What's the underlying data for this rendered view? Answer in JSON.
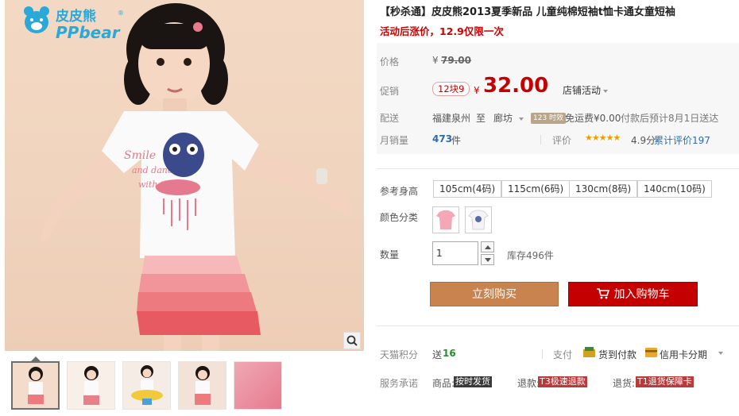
{
  "brand": {
    "logo_cn": "皮皮熊",
    "logo_en": "PPbear",
    "reg": "®"
  },
  "gallery": {
    "thumb_count": 5,
    "active_index": 0
  },
  "title": "【秒杀通】皮皮熊2013夏季新品 儿童纯棉短袖t恤卡通女童短袖",
  "subtitle": "活动后涨价，12.9仅限一次",
  "price": {
    "label": "价格",
    "currency": "¥",
    "original": "79.00"
  },
  "promo": {
    "label": "促销",
    "tag": "12块9",
    "currency": "¥",
    "value": "32.00",
    "shop_activity": "店铺活动"
  },
  "delivery": {
    "label": "配送",
    "from": "福建泉州",
    "to_word": "至",
    "to": "廊坊",
    "badge": "123 时效",
    "shipping": "免运费¥0.00",
    "eta": "付款后预计8月1日送达"
  },
  "sales": {
    "label": "月销量",
    "count": "473",
    "unit": "件",
    "rating_label": "评价",
    "stars": "★★★★★",
    "score": "4.9分",
    "total": "累计评价197"
  },
  "options": {
    "height_label": "参考身高",
    "sizes": [
      "105cm(4码)",
      "115cm(6码)",
      "130cm(8码)",
      "140cm(10码)"
    ],
    "color_label": "颜色分类"
  },
  "quantity": {
    "label": "数量",
    "value": "1",
    "stock": "库存496件"
  },
  "actions": {
    "buy_now": "立刻购买",
    "add_to_cart": "加入购物车"
  },
  "points": {
    "label": "天猫积分",
    "text": "送",
    "value": "16"
  },
  "payment": {
    "label": "支付",
    "cod": "货到付款",
    "credit": "信用卡分期"
  },
  "service": {
    "label": "服务承诺",
    "items": [
      {
        "prefix": "商品:",
        "tag": "按时发货",
        "color": "#3a3a3a"
      },
      {
        "prefix": "退款:",
        "tag": "T3极速退款",
        "color": "#b83a3a"
      },
      {
        "prefix": "退货:",
        "tag": "T1退货保障卡",
        "color": "#b83a3a"
      }
    ]
  },
  "colors": {
    "accent": "#c40000",
    "buy": "#c9834e",
    "brand": "#2aa9d9"
  }
}
